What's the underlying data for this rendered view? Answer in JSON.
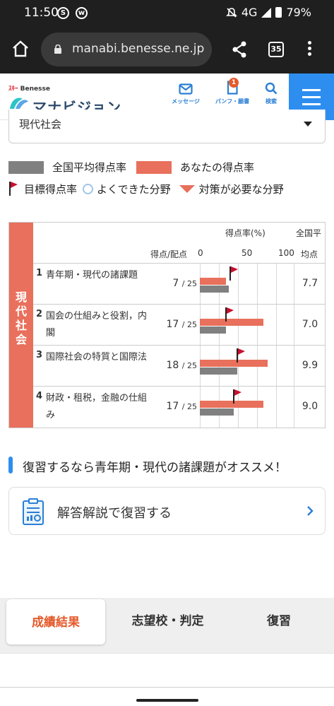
{
  "status_bar": {
    "time": "11:50",
    "app_icons": [
      "S",
      "w"
    ],
    "network": "4G",
    "battery": "79%"
  },
  "browser": {
    "url": "manabi.benesse.ne.jp",
    "tab_count": "35"
  },
  "site_header": {
    "brand_small": "Benesse",
    "brand_name": "マナビジョン",
    "nav": [
      {
        "label": "メッセージ",
        "icon": "mail-icon"
      },
      {
        "label": "パンフ・願書",
        "icon": "document-icon",
        "badge": "1"
      },
      {
        "label": "検索",
        "icon": "search-icon"
      }
    ]
  },
  "subject_select": {
    "value": "現代社会"
  },
  "legend": {
    "national_avg": "全国平均得点率",
    "your_rate": "あなたの得点率",
    "target_rate": "目標得点率",
    "good_area": "よくできた分野",
    "needs_work": "対策が必要な分野"
  },
  "results": {
    "subject": "現代社会",
    "headers": {
      "rate": "得点率(%)",
      "score": "得点/配点",
      "scale": [
        "0",
        "50",
        "100"
      ],
      "avg_line1": "全国平",
      "avg_line2": "均点"
    },
    "rows": [
      {
        "num": "1",
        "label": "青年期・現代の諸課題",
        "score": "7",
        "max": "/ 25",
        "avg": "7.7"
      },
      {
        "num": "2",
        "label": "国会の仕組みと役割，内閣",
        "score": "17",
        "max": "/ 25",
        "avg": "7.0"
      },
      {
        "num": "3",
        "label": "国際社会の特質と国際法",
        "score": "18",
        "max": "/ 25",
        "avg": "9.9"
      },
      {
        "num": "4",
        "label": "財政・租税，金融の仕組み",
        "score": "17",
        "max": "/ 25",
        "avg": "9.0"
      }
    ]
  },
  "chart_data": {
    "type": "bar",
    "categories": [
      "青年期・現代の諸課題",
      "国会の仕組みと役割，内閣",
      "国際社会の特質と国際法",
      "財政・租税，金融の仕組み"
    ],
    "series": [
      {
        "name": "あなたの得点率",
        "values": [
          28,
          68,
          72,
          68
        ]
      },
      {
        "name": "全国平均得点率",
        "values": [
          31,
          28,
          40,
          36
        ]
      },
      {
        "name": "目標得点率",
        "values": [
          32,
          28,
          40,
          36
        ]
      }
    ],
    "ylim": [
      0,
      100
    ],
    "colors": {
      "you": "#e8705c",
      "avg": "#808080",
      "target": "#c8102e"
    }
  },
  "recommendation": {
    "text": "復習するなら青年期・現代の諸課題がオススメ！",
    "action": "解答解説で復習する"
  },
  "bottom_tabs": [
    "成績結果",
    "志望校・判定",
    "復習"
  ],
  "colors": {
    "accent_blue": "#2e8ef0",
    "brand_orange": "#e55a2b",
    "subject_red": "#e8705c"
  }
}
